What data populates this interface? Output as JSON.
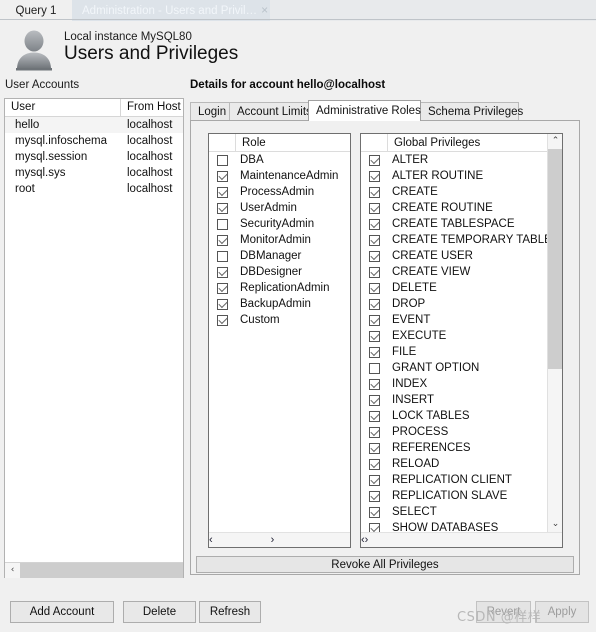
{
  "window": {
    "tabs": [
      {
        "label": "Query 1",
        "active": false
      },
      {
        "label": "Administration - Users and Privil…",
        "active": true,
        "close_icon": "×"
      }
    ]
  },
  "header": {
    "instance": "Local instance MySQL80",
    "title": "Users and Privileges",
    "avatar_icon": "user-avatar"
  },
  "accounts": {
    "section_label": "User Accounts",
    "columns": [
      "User",
      "From Host"
    ],
    "rows": [
      {
        "user": "hello",
        "host": "localhost",
        "selected": true
      },
      {
        "user": "mysql.infoschema",
        "host": "localhost",
        "selected": false
      },
      {
        "user": "mysql.session",
        "host": "localhost",
        "selected": false
      },
      {
        "user": "mysql.sys",
        "host": "localhost",
        "selected": false
      },
      {
        "user": "root",
        "host": "localhost",
        "selected": false
      }
    ],
    "hscroll_left_arrow": "‹",
    "hscroll_right_arrow": "›"
  },
  "details": {
    "title": "Details for account hello@localhost",
    "tabs": [
      {
        "label": "Login",
        "active": false
      },
      {
        "label": "Account Limits",
        "active": false
      },
      {
        "label": "Administrative Roles",
        "active": true
      },
      {
        "label": "Schema Privileges",
        "active": false
      }
    ],
    "roles": {
      "header": "Role",
      "items": [
        {
          "label": "DBA",
          "checked": false
        },
        {
          "label": "MaintenanceAdmin",
          "checked": true
        },
        {
          "label": "ProcessAdmin",
          "checked": true
        },
        {
          "label": "UserAdmin",
          "checked": true
        },
        {
          "label": "SecurityAdmin",
          "checked": false
        },
        {
          "label": "MonitorAdmin",
          "checked": true
        },
        {
          "label": "DBManager",
          "checked": false
        },
        {
          "label": "DBDesigner",
          "checked": true
        },
        {
          "label": "ReplicationAdmin",
          "checked": true
        },
        {
          "label": "BackupAdmin",
          "checked": true
        },
        {
          "label": "Custom",
          "checked": true
        }
      ]
    },
    "privileges": {
      "header": "Global Privileges",
      "items": [
        {
          "label": "ALTER",
          "checked": true
        },
        {
          "label": "ALTER ROUTINE",
          "checked": true
        },
        {
          "label": "CREATE",
          "checked": true
        },
        {
          "label": "CREATE ROUTINE",
          "checked": true
        },
        {
          "label": "CREATE TABLESPACE",
          "checked": true
        },
        {
          "label": "CREATE TEMPORARY TABLES",
          "checked": true
        },
        {
          "label": "CREATE USER",
          "checked": true
        },
        {
          "label": "CREATE VIEW",
          "checked": true
        },
        {
          "label": "DELETE",
          "checked": true
        },
        {
          "label": "DROP",
          "checked": true
        },
        {
          "label": "EVENT",
          "checked": true
        },
        {
          "label": "EXECUTE",
          "checked": true
        },
        {
          "label": "FILE",
          "checked": true
        },
        {
          "label": "GRANT OPTION",
          "checked": false
        },
        {
          "label": "INDEX",
          "checked": true
        },
        {
          "label": "INSERT",
          "checked": true
        },
        {
          "label": "LOCK TABLES",
          "checked": true
        },
        {
          "label": "PROCESS",
          "checked": true
        },
        {
          "label": "REFERENCES",
          "checked": true
        },
        {
          "label": "RELOAD",
          "checked": true
        },
        {
          "label": "REPLICATION CLIENT",
          "checked": true
        },
        {
          "label": "REPLICATION SLAVE",
          "checked": true
        },
        {
          "label": "SELECT",
          "checked": true
        },
        {
          "label": "SHOW DATABASES",
          "checked": true
        }
      ],
      "scroll_up_arrow": "⌃",
      "scroll_down_arrow": "⌄"
    },
    "revoke_button": "Revoke All Privileges"
  },
  "footer": {
    "add_account": "Add Account",
    "delete": "Delete",
    "refresh": "Refresh",
    "revert": "Revert",
    "apply": "Apply"
  },
  "watermark": "CSDN @样样",
  "colors": {
    "window_bg": "#f0f0f0",
    "tab_active_bg": "#dde3e9",
    "list_bg": "#ffffff",
    "scroll_thumb": "#cdcdcd",
    "border": "#a8a8a8"
  }
}
